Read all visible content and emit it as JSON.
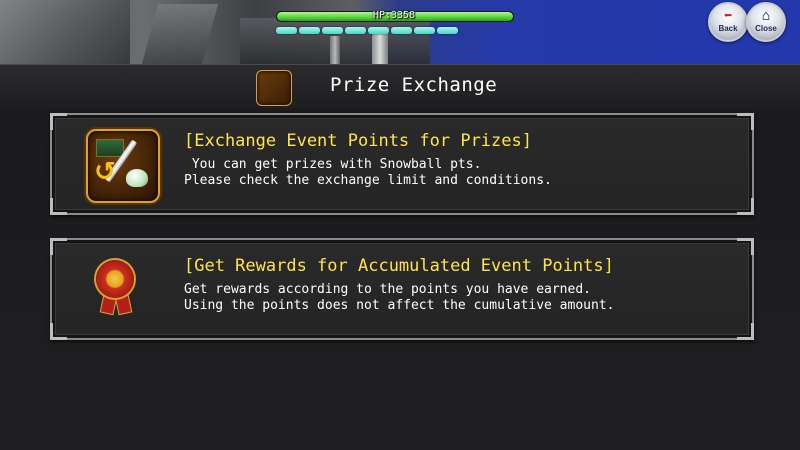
{
  "hud": {
    "hp_text": "HP:3358",
    "hp_fraction": 1.0,
    "stamina_segments": 8
  },
  "header_buttons": {
    "back_label": "Back",
    "close_label": "Close"
  },
  "title": {
    "text": "Prize Exchange",
    "icon": "prize-exchange-icon"
  },
  "menu": [
    {
      "heading": "[Exchange Event Points for Prizes]",
      "description": " You can get prizes with Snowball pts.\nPlease check the exchange limit and conditions.",
      "icon": "prize-exchange-icon"
    },
    {
      "heading": "[Get Rewards for Accumulated Event Points]",
      "description": "Get rewards according to the points you have earned.\nUsing the points does not affect the cumulative amount.",
      "icon": "medal-icon"
    }
  ],
  "colors": {
    "heading": "#ffe44a",
    "body_text": "#ffffff",
    "hp_bar": "#55d23c",
    "stamina": "#4ad6c8",
    "panel_border": "#8b8b8b"
  }
}
